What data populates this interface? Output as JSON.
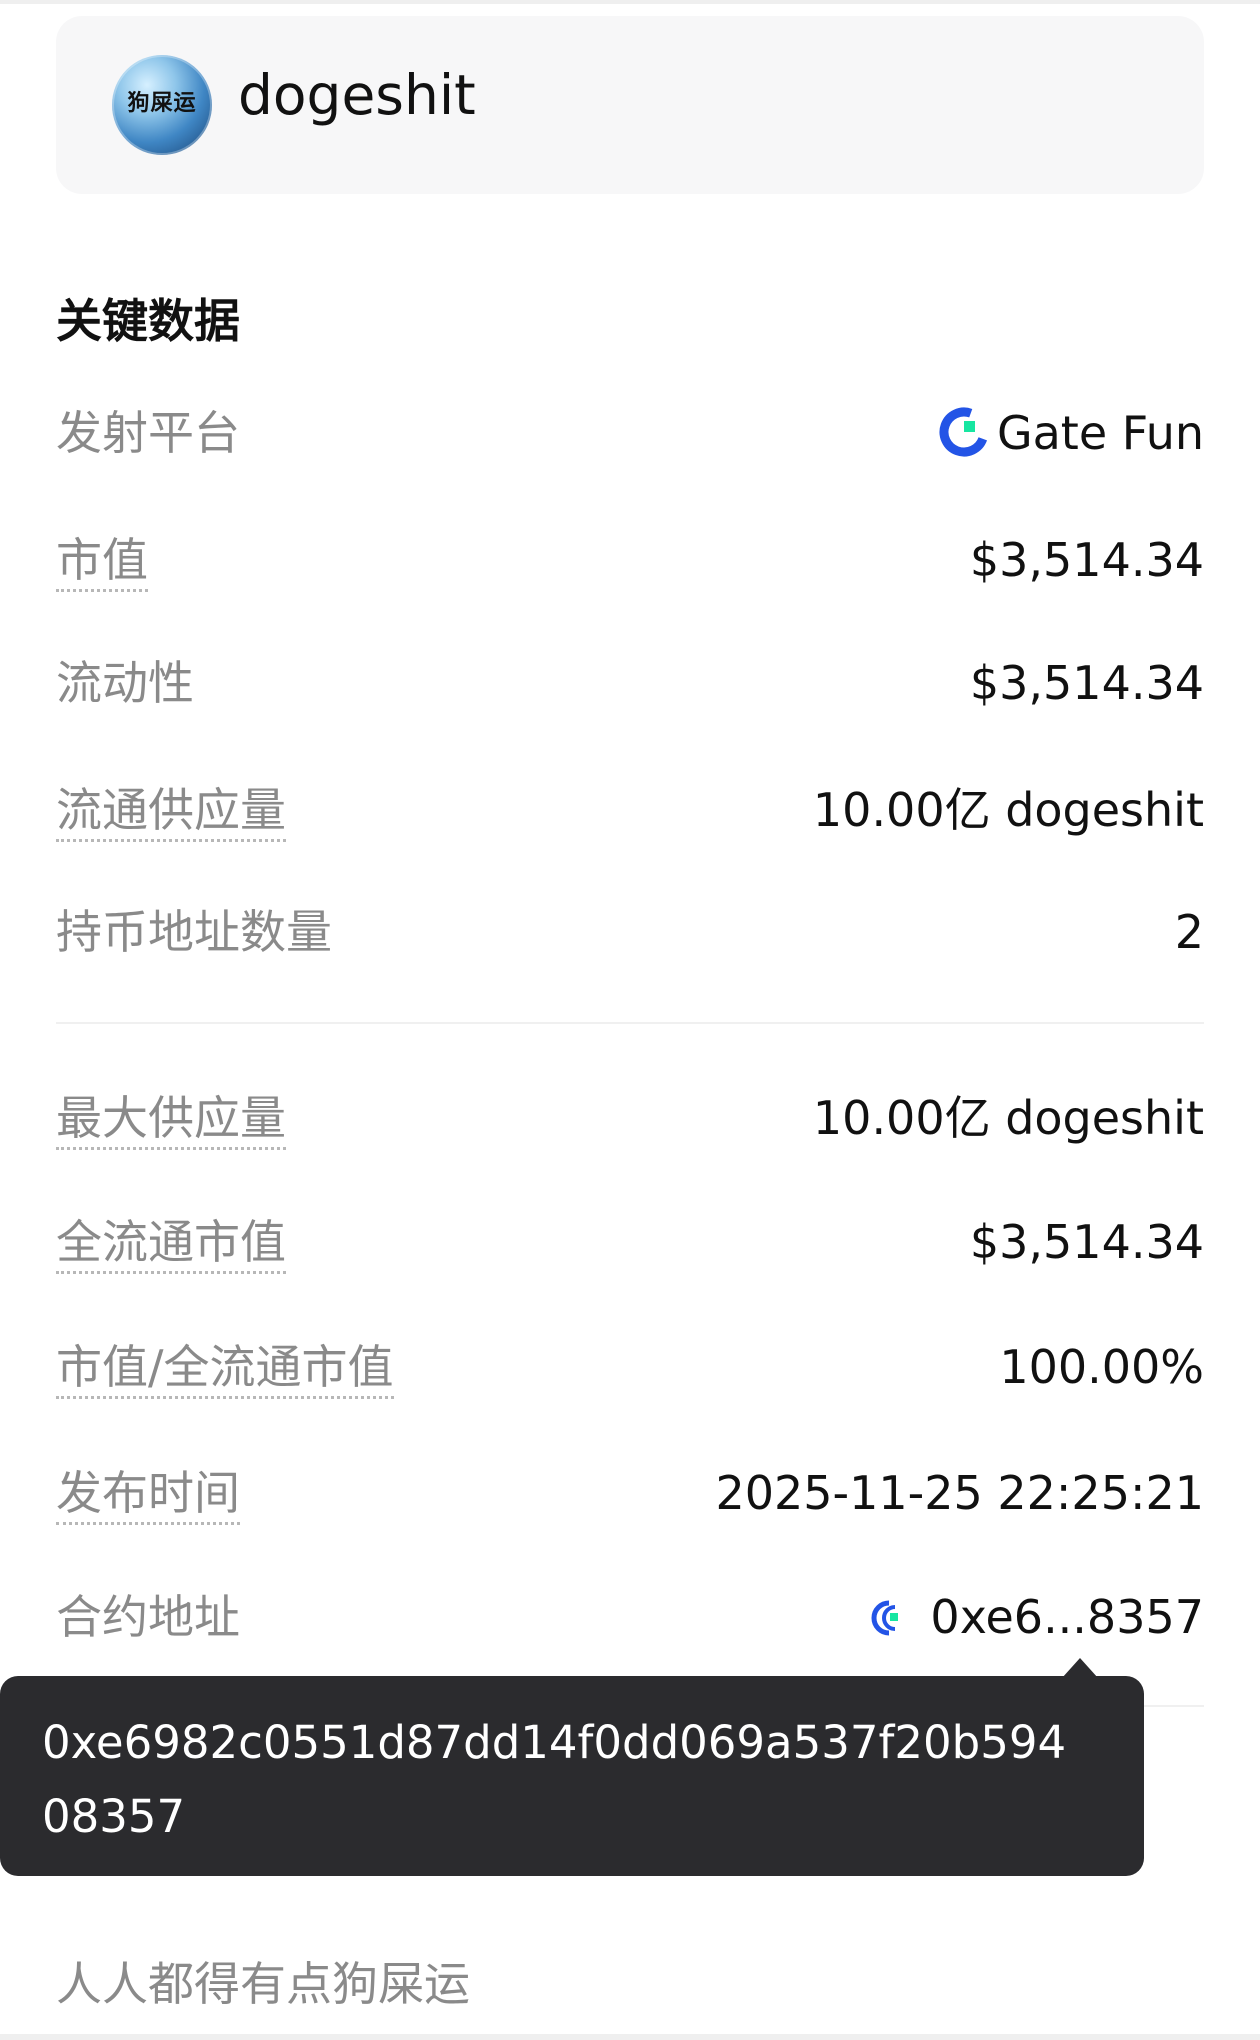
{
  "token": {
    "name": "dogeshit",
    "avatar_text": "狗屎运",
    "avatar_caption": ""
  },
  "key_data": {
    "title": "关键数据",
    "launch_platform": {
      "label": "发射平台",
      "value": "Gate Fun",
      "icon": "gate-fun-icon"
    },
    "market_cap": {
      "label": "市值",
      "value": "$3,514.34"
    },
    "liquidity": {
      "label": "流动性",
      "value": "$3,514.34"
    },
    "circulating_supply": {
      "label": "流通供应量",
      "value": "10.00亿 dogeshit"
    },
    "holders": {
      "label": "持币地址数量",
      "value": "2"
    },
    "max_supply": {
      "label": "最大供应量",
      "value": "10.00亿 dogeshit"
    },
    "fdv": {
      "label": "全流通市值",
      "value": "$3,514.34"
    },
    "mc_fdv_ratio": {
      "label": "市值/全流通市值",
      "value": "100.00%"
    },
    "release_time": {
      "label": "发布时间",
      "value": "2025-11-25 22:25:21"
    },
    "contract": {
      "label": "合约地址",
      "value": "0xe6...8357",
      "icon": "gate-chain-icon"
    }
  },
  "tooltip": {
    "text": "0xe6982c0551d87dd14f0dd069a537f20b59408357"
  },
  "description": {
    "text": "人人都得有点狗屎运"
  },
  "colors": {
    "gate_blue": "#2354E6",
    "gate_green": "#17E6A1",
    "tooltip_bg": "#2B2B2E",
    "label_gray": "#8A8A8A"
  }
}
